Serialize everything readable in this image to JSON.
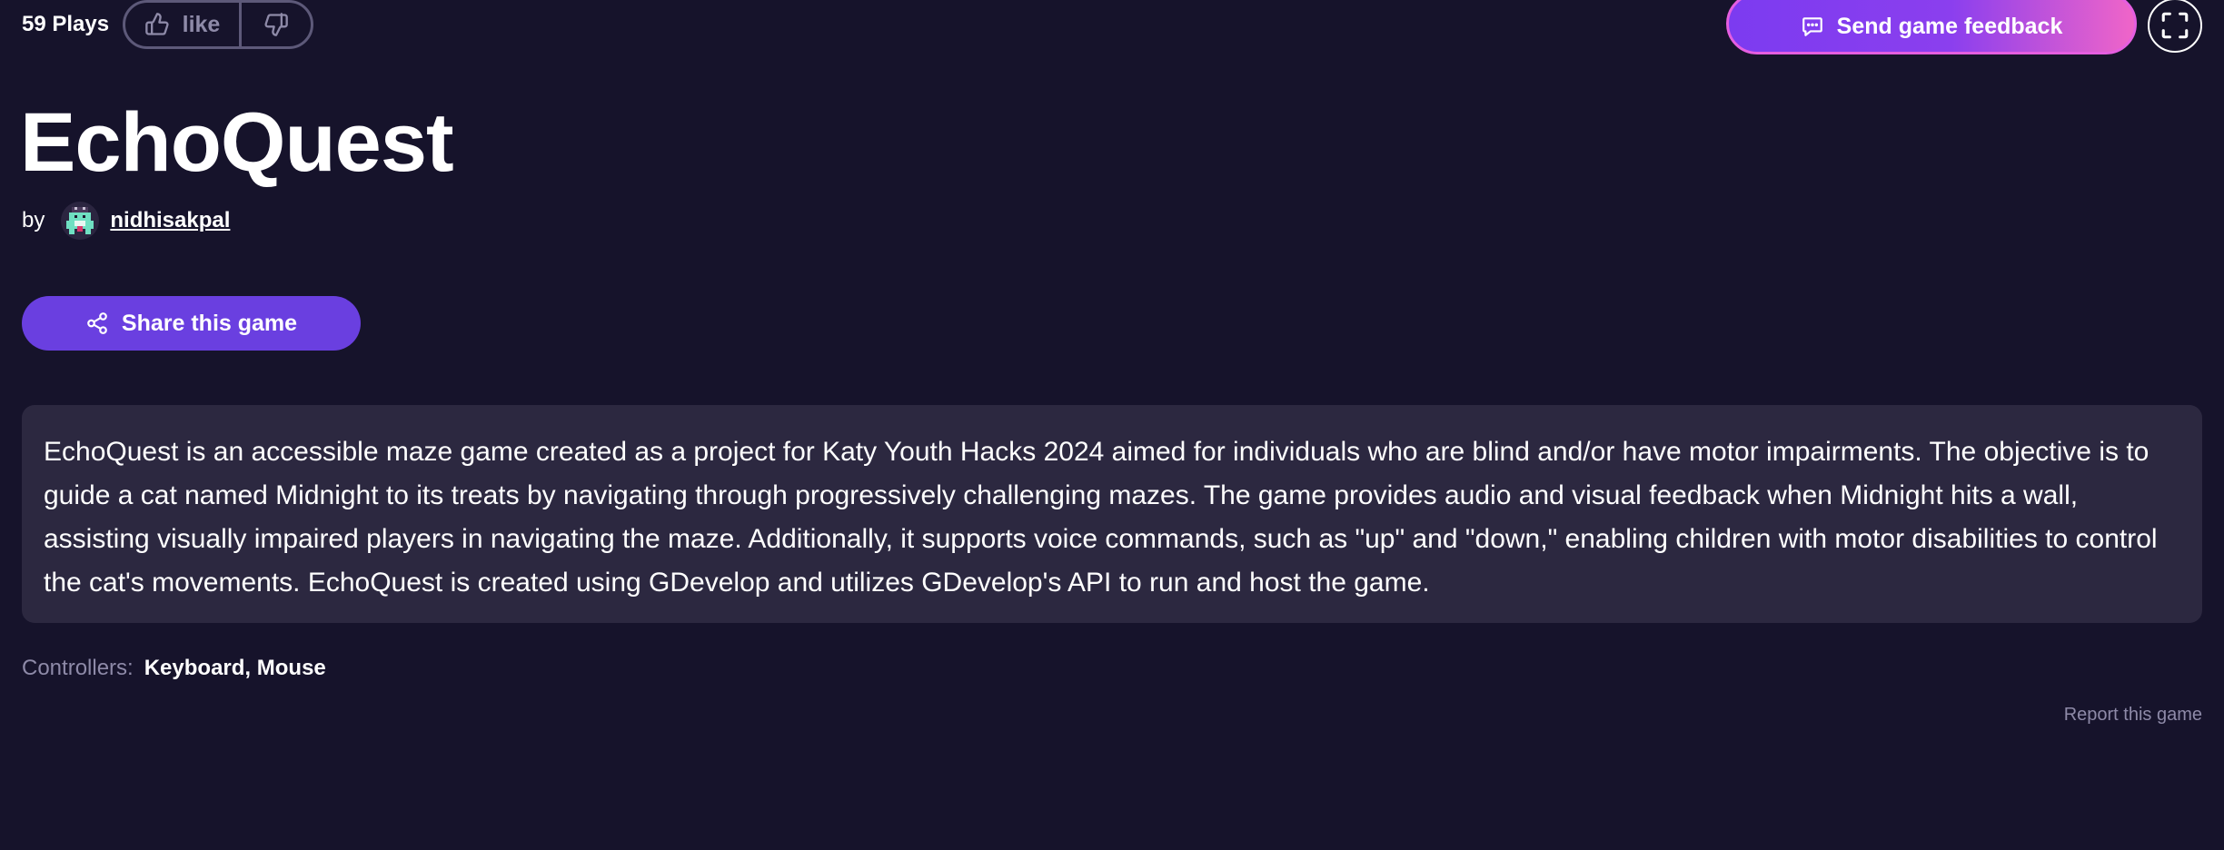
{
  "stats": {
    "plays": "59 Plays"
  },
  "votes": {
    "like_label": "like"
  },
  "actions": {
    "feedback_label": "Send game feedback",
    "share_label": "Share this game",
    "report_label": "Report this game"
  },
  "game": {
    "title": "EchoQuest",
    "by_label": "by",
    "author": "nidhisakpal",
    "description": "EchoQuest is an accessible maze game created as a project for Katy Youth Hacks 2024 aimed for individuals who are blind and/or have motor impairments. The objective is to guide a cat named Midnight to its treats by navigating through progressively challenging mazes. The game provides audio and visual feedback when Midnight hits a wall, assisting visually impaired players in navigating the maze. Additionally, it supports voice commands, such as \"up\" and \"down,\" enabling children with motor disabilities to control the cat's movements. EchoQuest is created using GDevelop and utilizes GDevelop's API to run and host the game.",
    "controllers_label": "Controllers:",
    "controllers_value": "Keyboard, Mouse"
  },
  "icons": {
    "like": "thumbs-up-icon",
    "dislike": "thumbs-down-icon",
    "feedback": "chat-bubble-icon",
    "fullscreen": "fullscreen-icon",
    "share": "share-icon"
  },
  "colors": {
    "background": "#16132b",
    "panel": "#2c2840",
    "accent": "#6a3fe0",
    "gradient_start": "#7c3bf0",
    "gradient_end": "#f065c8",
    "muted_text": "#8e8aa8"
  }
}
